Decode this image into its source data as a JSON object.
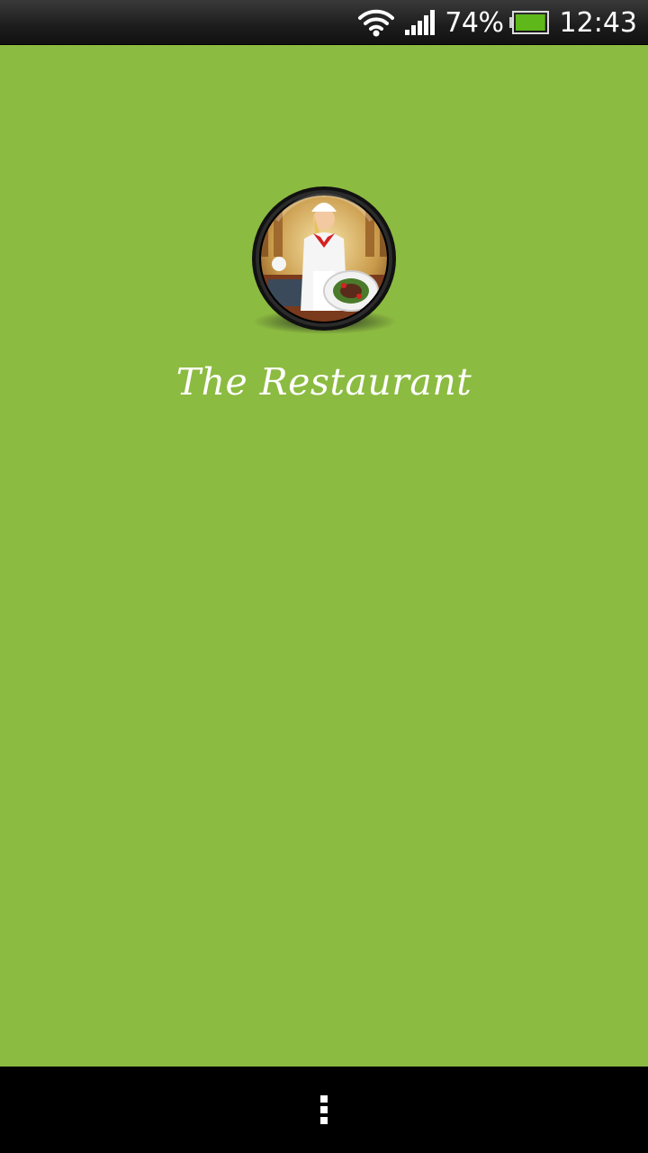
{
  "status_bar": {
    "battery_percent": "74%",
    "time": "12:43",
    "battery_level": 0.74,
    "icons": [
      "wifi-icon",
      "signal-icon",
      "battery-icon"
    ]
  },
  "app": {
    "title": "The Restaurant",
    "background_color": "#8cbb41",
    "logo_icon": "restaurant-chef-logo"
  },
  "nav_bar": {
    "menu_icon": "overflow-menu-icon"
  }
}
